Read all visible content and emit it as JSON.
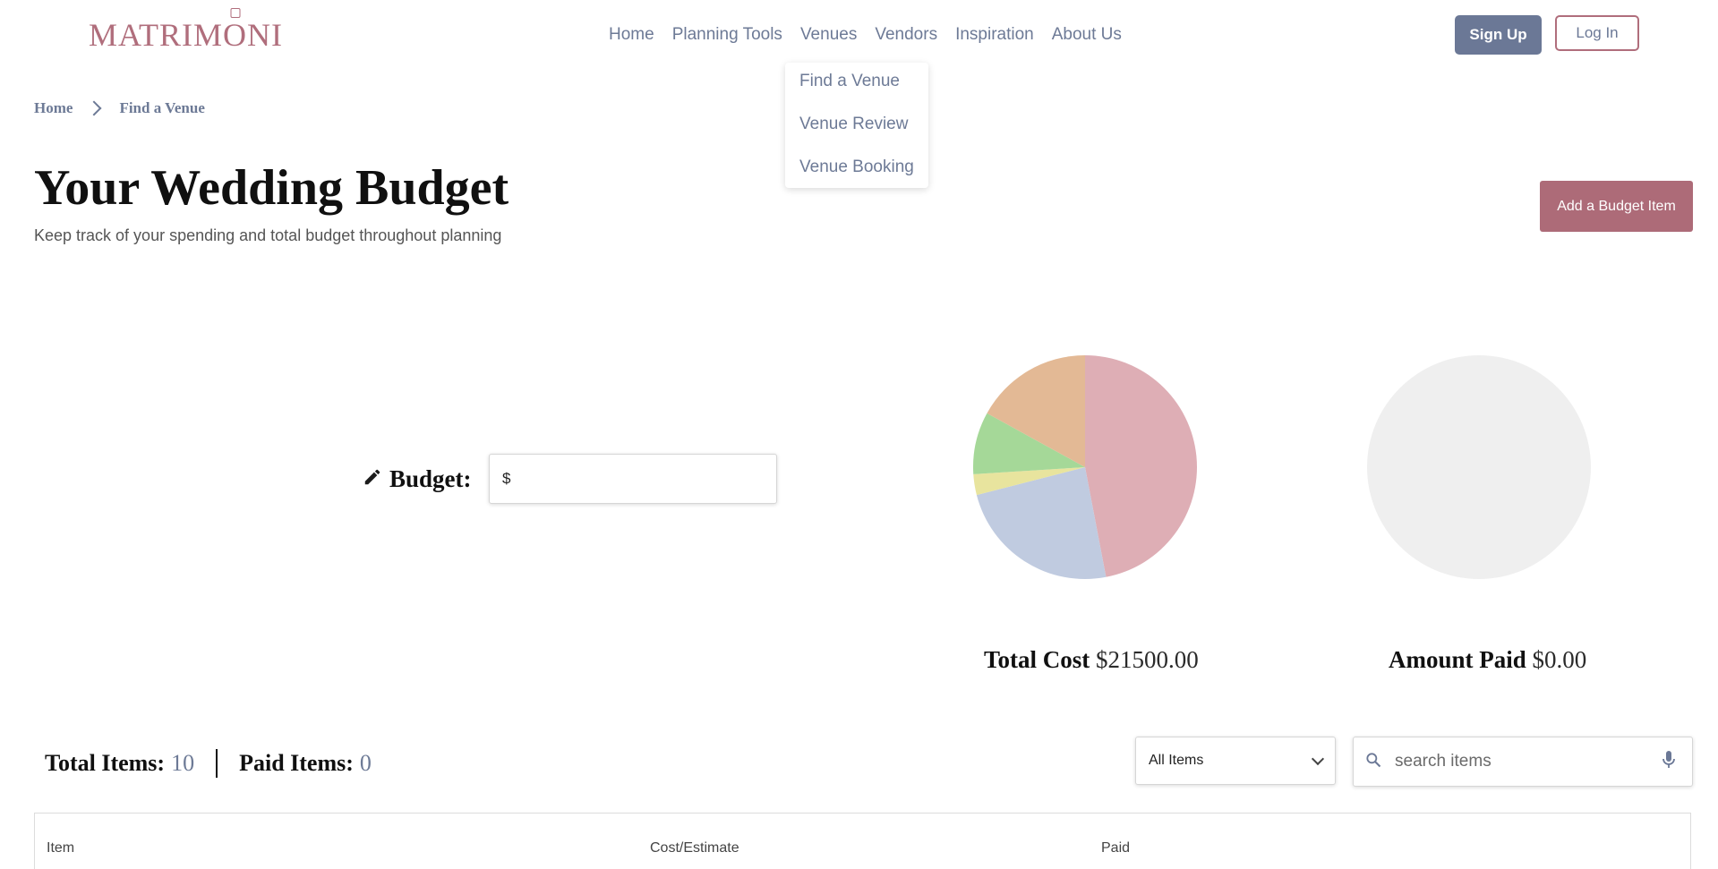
{
  "header": {
    "logo_pre": "MATRIM",
    "logo_ring": "O",
    "logo_post": "NI",
    "nav": [
      {
        "label": "Home"
      },
      {
        "label": "Planning Tools"
      },
      {
        "label": "Venues"
      },
      {
        "label": "Vendors"
      },
      {
        "label": "Inspiration"
      },
      {
        "label": "About Us"
      }
    ],
    "signup_label": "Sign Up",
    "login_label": "Log In"
  },
  "venues_dropdown": [
    {
      "label": "Find a Venue"
    },
    {
      "label": "Venue Review"
    },
    {
      "label": "Venue Booking"
    }
  ],
  "breadcrumb": {
    "home": "Home",
    "current": "Find a Venue"
  },
  "page": {
    "title": "Your Wedding Budget",
    "subtitle": "Keep track of your spending and total budget throughout planning",
    "add_button": "Add a Budget Item"
  },
  "budget": {
    "label": "Budget:",
    "currency": "$",
    "value": ""
  },
  "chart_data": [
    {
      "type": "pie",
      "slices": [
        {
          "value": 47,
          "color": "#deaeb5"
        },
        {
          "value": 24,
          "color": "#c0cbe0"
        },
        {
          "value": 3,
          "color": "#e8e49e"
        },
        {
          "value": 9,
          "color": "#a5d898"
        },
        {
          "value": 17,
          "color": "#e3b995"
        }
      ],
      "caption_label": "Total Cost",
      "caption_value": "$21500.00"
    },
    {
      "type": "pie",
      "slices": [
        {
          "value": 100,
          "color": "#efefef"
        }
      ],
      "caption_label": "Amount Paid",
      "caption_value": "$0.00"
    }
  ],
  "summary": {
    "total_label": "Total Items:",
    "total_value": "10",
    "paid_label": "Paid Items:",
    "paid_value": "0"
  },
  "filter": {
    "selected": "All Items"
  },
  "search": {
    "placeholder": "search items"
  },
  "table": {
    "columns": [
      "Item",
      "Cost/Estimate",
      "Paid"
    ]
  },
  "colors": {
    "brand": "#b06e7c",
    "nav_text": "#6d7a96",
    "signup_bg": "#6b7896",
    "add_button_bg": "#ad6b78"
  },
  "icons": {
    "budget_edit": "pencil-icon",
    "search": "search-icon",
    "voice": "microphone-icon",
    "breadcrumb_separator": "chevron-right-icon",
    "filter_caret": "chevron-down-icon"
  }
}
